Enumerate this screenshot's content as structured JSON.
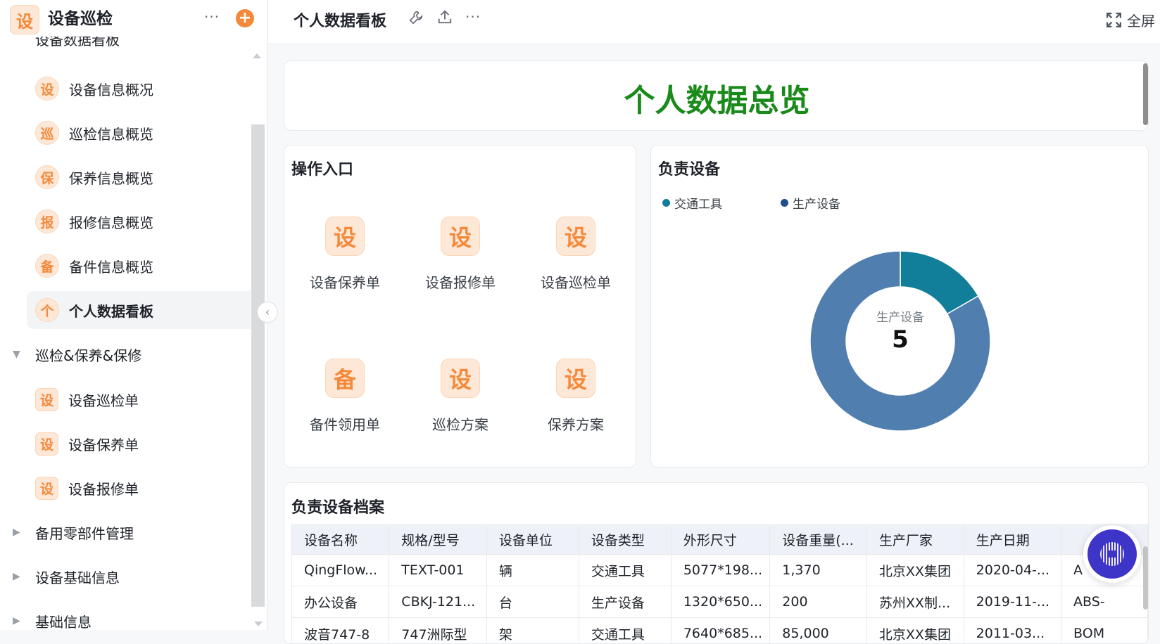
{
  "sidebar": {
    "app_icon": "设",
    "app_title": "设备巡检",
    "more": "···",
    "add": "+",
    "clipped_item": "设备数据看板",
    "items": [
      {
        "icon": "设",
        "label": "设备信息概况"
      },
      {
        "icon": "巡",
        "label": "巡检信息概览"
      },
      {
        "icon": "保",
        "label": "保养信息概览"
      },
      {
        "icon": "报",
        "label": "报修信息概览"
      },
      {
        "icon": "备",
        "label": "备件信息概览"
      },
      {
        "icon": "个",
        "label": "个人数据看板"
      }
    ],
    "group": "巡检&保养&保修",
    "group_items": [
      {
        "icon": "设",
        "label": "设备巡检单"
      },
      {
        "icon": "设",
        "label": "设备保养单"
      },
      {
        "icon": "设",
        "label": "设备报修单"
      }
    ],
    "collapsed_groups": [
      "备用零部件管理",
      "设备基础信息",
      "基础信息"
    ]
  },
  "header": {
    "title": "个人数据看板",
    "more": "···",
    "fullscreen": "全屏"
  },
  "banner": {
    "title": "个人数据总览",
    "color": "#1a8a1a"
  },
  "ops": {
    "title": "操作入口",
    "tiles": [
      {
        "icon": "设",
        "label": "设备保养单"
      },
      {
        "icon": "设",
        "label": "设备报修单"
      },
      {
        "icon": "设",
        "label": "设备巡检单"
      },
      {
        "icon": "备",
        "label": "备件领用单"
      },
      {
        "icon": "设",
        "label": "巡检方案"
      },
      {
        "icon": "设",
        "label": "保养方案"
      }
    ]
  },
  "chart_data": {
    "type": "pie",
    "title": "负责设备",
    "legend": [
      {
        "name": "交通工具",
        "color": "#117e9a"
      },
      {
        "name": "生产设备",
        "color": "#1f4e8c"
      }
    ],
    "series": [
      {
        "name": "交通工具",
        "value": 1,
        "color": "#117e9a"
      },
      {
        "name": "生产设备",
        "value": 5,
        "color": "#507eaf"
      }
    ],
    "center_label": "生产设备",
    "center_value": "5",
    "legend_position": "top-left"
  },
  "table": {
    "title": "负责设备档案",
    "columns": [
      "设备名称",
      "规格/型号",
      "设备单位",
      "设备类型",
      "外形尺寸",
      "设备重量(...",
      "生产厂家",
      "生产日期",
      ""
    ],
    "rows": [
      [
        "QingFlow...",
        "TEXT-001",
        "辆",
        "交通工具",
        "5077*198...",
        "1,370",
        "北京XX集团",
        "2020-04-...",
        "A"
      ],
      [
        "办公设备",
        "CBKJ-121...",
        "台",
        "生产设备",
        "1320*650...",
        "200",
        "苏州XX制...",
        "2019-11-...",
        "ABS-"
      ],
      [
        "波音747-8",
        "747洲际型",
        "架",
        "交通工具",
        "7640*685...",
        "85,000",
        "北京XX集团",
        "2011-03...",
        "BOM"
      ]
    ]
  }
}
